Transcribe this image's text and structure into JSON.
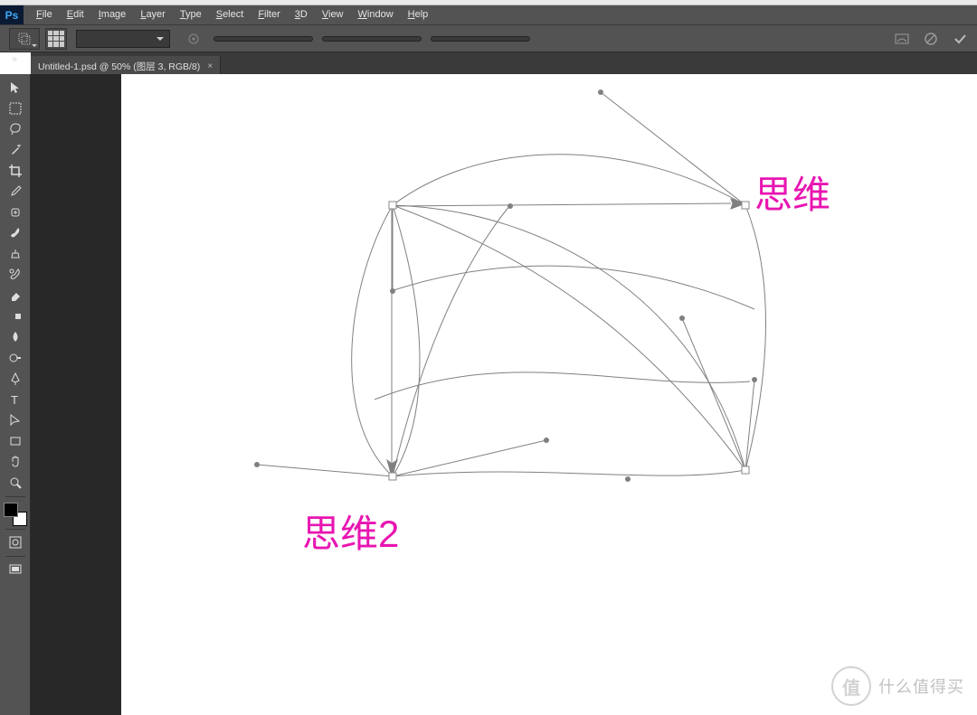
{
  "app": {
    "logo_text": "Ps"
  },
  "menu": {
    "items": [
      {
        "label": "File",
        "accel": "F"
      },
      {
        "label": "Edit",
        "accel": "E"
      },
      {
        "label": "Image",
        "accel": "I"
      },
      {
        "label": "Layer",
        "accel": "L"
      },
      {
        "label": "Type",
        "accel": "T"
      },
      {
        "label": "Select",
        "accel": "S"
      },
      {
        "label": "Filter",
        "accel": "F"
      },
      {
        "label": "3D",
        "accel": "3"
      },
      {
        "label": "View",
        "accel": "V"
      },
      {
        "label": "Window",
        "accel": "W"
      },
      {
        "label": "Help",
        "accel": "H"
      }
    ]
  },
  "document_tab": {
    "title": "Untitled-1.psd @ 50% (图层 3, RGB/8)",
    "close": "×"
  },
  "annotations": {
    "label1": "思维",
    "label2": "思维2"
  },
  "tools": [
    "move",
    "rect-marquee",
    "lasso",
    "magic-wand",
    "crop",
    "eyedropper",
    "spot-heal",
    "brush",
    "clone-stamp",
    "history-brush",
    "eraser",
    "gradient",
    "blur",
    "dodge",
    "pen",
    "type",
    "path-select",
    "rectangle",
    "hand",
    "zoom"
  ],
  "watermark": {
    "icon": "值",
    "text": "什么值得买"
  }
}
